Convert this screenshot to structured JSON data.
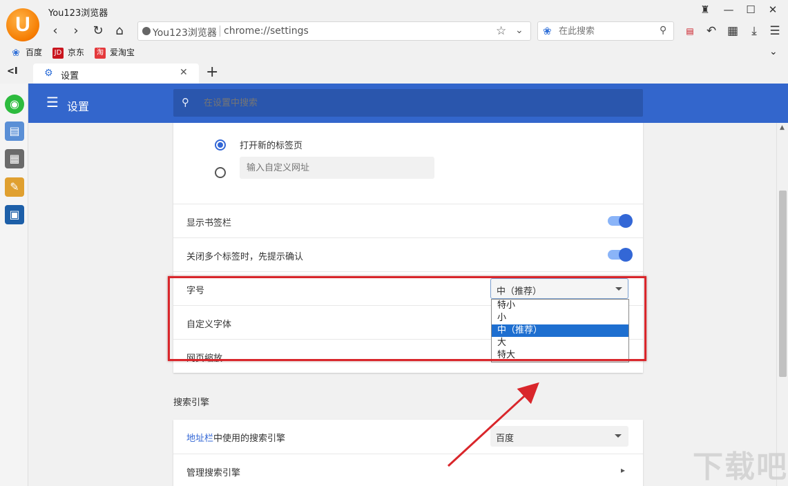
{
  "window": {
    "title": "You123浏览器",
    "logo_letter": "U"
  },
  "toolbar": {
    "address_site": "You123浏览器",
    "address_url": "chrome://settings",
    "search_placeholder": "在此搜索"
  },
  "bookmarks": [
    {
      "label": "百度",
      "icon": "baidu-paw-icon",
      "color": "#2f6fd8"
    },
    {
      "label": "京东",
      "icon": "jd-logo-icon",
      "color": "#c9151e",
      "badge": "JD"
    },
    {
      "label": "爱淘宝",
      "icon": "taobao-logo-icon",
      "color": "#e4393c",
      "badge": "淘"
    }
  ],
  "tab": {
    "label": "设置"
  },
  "settings": {
    "header_title": "设置",
    "search_placeholder": "在设置中搜索",
    "startup": {
      "option_new_tab": "打开新的标签页",
      "custom_url_placeholder": "输入自定义网址"
    },
    "rows": {
      "show_bookmarks": "显示书签栏",
      "confirm_close": "关闭多个标签时，先提示确认",
      "font_size": "字号",
      "custom_fonts": "自定义字体",
      "page_zoom": "网页缩放"
    },
    "font_size_value": "中（推荐）",
    "font_size_options": [
      "特小",
      "小",
      "中（推荐）",
      "大",
      "特大"
    ],
    "search_engine_section": "搜索引擎",
    "search_engine_link": "地址栏",
    "search_engine_label_rest": "中使用的搜索引擎",
    "search_engine_value": "百度",
    "manage_search_engines": "管理搜索引擎"
  },
  "colors": {
    "header_blue": "#3366cc",
    "accent": "#3367d6",
    "highlight_red": "#d9262b"
  },
  "watermark": "下载吧"
}
